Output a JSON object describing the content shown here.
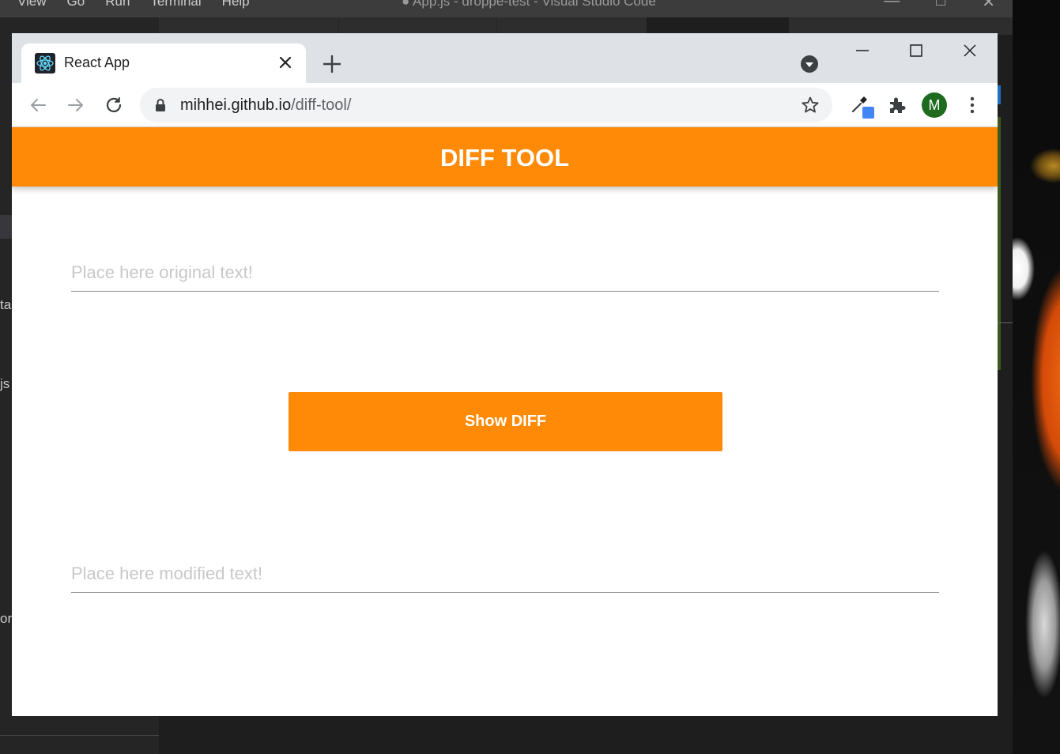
{
  "vscode": {
    "menu": [
      "View",
      "Go",
      "Run",
      "Terminal",
      "Help"
    ],
    "title": "● App.js - droppe-test - Visual Studio Code",
    "sidebar_fragments": [
      "ta",
      "js",
      "or"
    ]
  },
  "browser": {
    "tab": {
      "title": "React App",
      "favicon": "react-logo-icon"
    },
    "address": {
      "host": "mihhei.github.io",
      "path": "/diff-tool/"
    },
    "profile_initial": "M",
    "colors": {
      "tabstrip": "#dee1e6",
      "omnibox": "#f1f3f4",
      "avatar": "#1e6a1e"
    }
  },
  "app": {
    "title": "DIFF TOOL",
    "original_placeholder": "Place here original text!",
    "modified_placeholder": "Place here modified text!",
    "show_diff_label": "Show DIFF",
    "colors": {
      "accent": "#fe8a07",
      "header_text": "#ffffff"
    }
  }
}
